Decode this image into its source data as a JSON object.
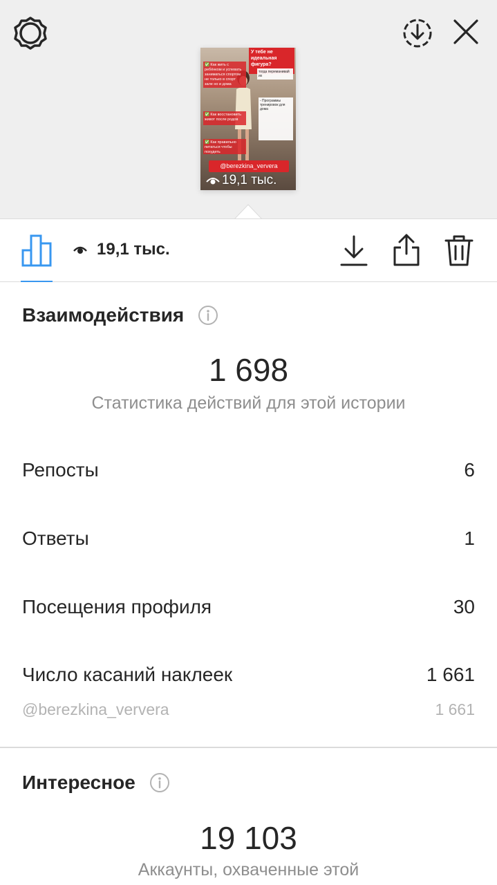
{
  "header": {
    "icons": [
      "gear-icon",
      "download-circle-icon",
      "close-icon"
    ]
  },
  "story": {
    "banner": "У тебе не идеальная фигура?",
    "questions": [
      "✅ Как жить с ребёнком и успевать заниматься спортом не только в спорт зале но и дома",
      "✅ Как восстановить живот после родов",
      "✅ Как правильно питаться чтобы похудеть"
    ],
    "notes": [
      "тогда переманивай их",
      "- Программы тренировок для дома"
    ],
    "tag": "@berezkina_ververa",
    "views": "19,1 тыс."
  },
  "toolbar": {
    "views": "19,1 тыс.",
    "icons": [
      "bar-chart-icon",
      "eye-icon",
      "download-icon",
      "share-icon",
      "trash-icon"
    ]
  },
  "interactions": {
    "title": "Взаимодействия",
    "total": "1 698",
    "caption": "Статистика действий для этой истории",
    "rows": [
      {
        "label": "Репосты",
        "value": "6"
      },
      {
        "label": "Ответы",
        "value": "1"
      },
      {
        "label": "Посещения профиля",
        "value": "30"
      },
      {
        "label": "Число касаний наклеек",
        "value": "1 661"
      }
    ],
    "sticker": {
      "label": "@berezkina_ververa",
      "value": "1 661"
    }
  },
  "discovery": {
    "title": "Интересное",
    "total": "19 103",
    "caption": "Аккаунты, охваченные этой"
  },
  "colors": {
    "accent": "#3897f0",
    "story_red": "#d9262a",
    "muted_text": "#8e8e8e"
  }
}
